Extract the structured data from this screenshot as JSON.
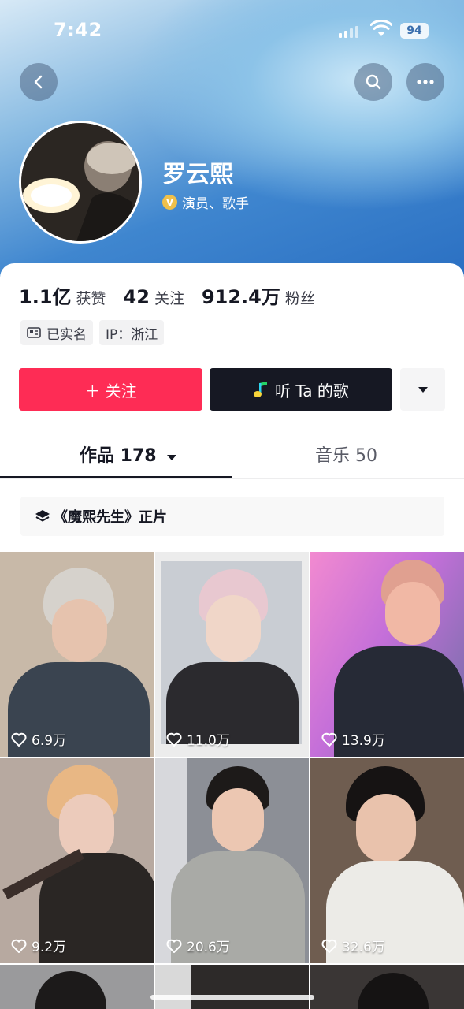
{
  "status_bar": {
    "time": "7:42",
    "battery": "94"
  },
  "profile": {
    "name": "罗云熙",
    "verify_badge": "V",
    "verify_text": "演员、歌手"
  },
  "stats": [
    {
      "value": "1.1亿",
      "label": "获赞"
    },
    {
      "value": "42",
      "label": "关注"
    },
    {
      "value": "912.4万",
      "label": "粉丝"
    }
  ],
  "tags": {
    "realname": "已实名",
    "ip": "IP：浙江"
  },
  "actions": {
    "follow": "＋ 关注",
    "listen": "听 Ta 的歌"
  },
  "tabs": {
    "works": "作品 178",
    "music": "音乐 50"
  },
  "collection": {
    "label": "《魔熙先生》正片"
  },
  "videos": [
    {
      "likes": "6.9万"
    },
    {
      "likes": "11.0万"
    },
    {
      "likes": "13.9万"
    },
    {
      "likes": "9.2万"
    },
    {
      "likes": "20.6万"
    },
    {
      "likes": "32.6万"
    }
  ],
  "colors": {
    "follow_red": "#fe2c55",
    "dark": "#161823",
    "header_blue": "#3f86cf"
  }
}
